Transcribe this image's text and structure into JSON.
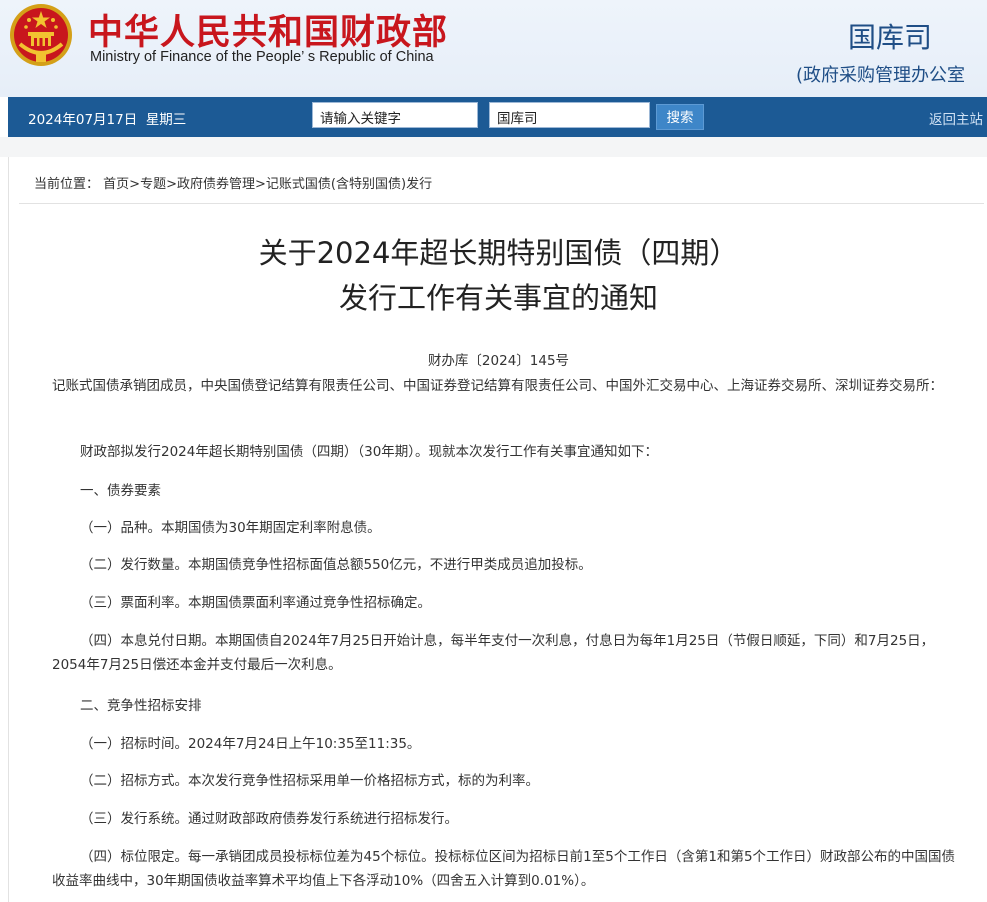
{
  "header": {
    "site_name_cn": "中华人民共和国财政部",
    "site_name_en": "Ministry of Finance of the People’ s Republic of China",
    "department": "国库司",
    "department_sub": "(政府采购管理办公室",
    "colors": {
      "brand_red": "#c8161d",
      "nav_blue": "#1c5a95",
      "dept_blue": "#1f4e86"
    }
  },
  "nav": {
    "date": "2024年07月17日",
    "weekday": "星期三",
    "search_placeholder": "请输入关键字",
    "search_scope": "国库司",
    "search_button": "搜索",
    "home_link": "返回主站"
  },
  "breadcrumb": {
    "prefix": "当前位置：",
    "items": [
      "首页",
      "专题",
      "政府债券管理",
      "记账式国债(含特别国债)发行"
    ],
    "separator": ">"
  },
  "article": {
    "title_line1": "关于2024年超长期特别国债（四期）",
    "title_line2": "发行工作有关事宜的通知",
    "doc_number": "财办库〔2024〕145号",
    "recipients": "记账式国债承销团成员，中央国债登记结算有限责任公司、中国证券登记结算有限责任公司、中国外汇交易中心、上海证券交易所、深圳证券交易所：",
    "intro": "财政部拟发行2024年超长期特别国债（四期）（30年期）。现就本次发行工作有关事宜通知如下：",
    "section1": "一、债券要素",
    "s1_1": "（一）品种。本期国债为30年期固定利率附息债。",
    "s1_2": "（二）发行数量。本期国债竞争性招标面值总额550亿元，不进行甲类成员追加投标。",
    "s1_3": "（三）票面利率。本期国债票面利率通过竞争性招标确定。",
    "s1_4": "（四）本息兑付日期。本期国债自2024年7月25日开始计息，每半年支付一次利息，付息日为每年1月25日（节假日顺延，下同）和7月25日，2054年7月25日偿还本金并支付最后一次利息。",
    "section2": "二、竞争性招标安排",
    "s2_1": "（一）招标时间。2024年7月24日上午10:35至11:35。",
    "s2_2": "（二）招标方式。本次发行竞争性招标采用单一价格招标方式，标的为利率。",
    "s2_3": "（三）发行系统。通过财政部政府债券发行系统进行招标发行。",
    "s2_4": "（四）标位限定。每一承销团成员投标标位差为45个标位。投标标位区间为招标日前1至5个工作日（含第1和第5个工作日）财政部公布的中国国债收益率曲线中，30年期国债收益率算术平均值上下各浮动10%（四舍五入计算到0.01%）。"
  }
}
